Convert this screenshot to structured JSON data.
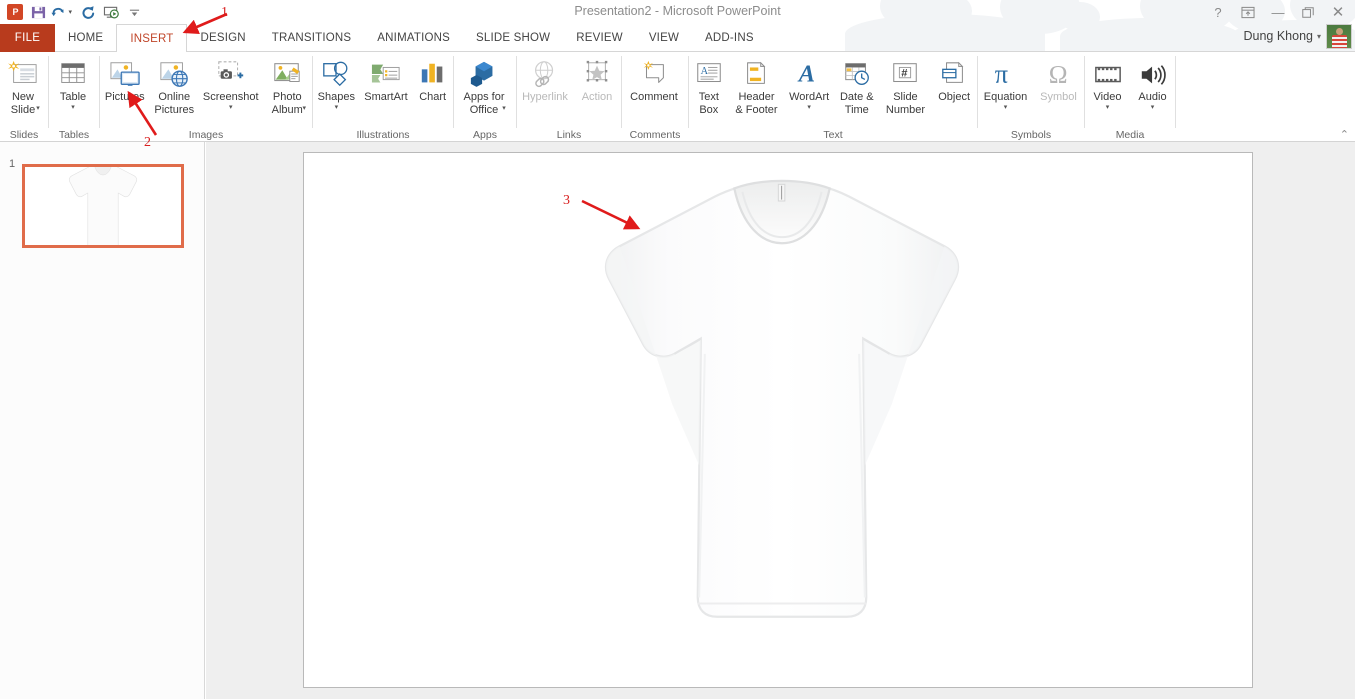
{
  "window": {
    "title": "Presentation2 - Microsoft PowerPoint",
    "help_icon": "?",
    "ribbon_display_icon": "⤒",
    "minimize_icon": "—",
    "restore_icon": "❐",
    "close_icon": "✕",
    "collapse_ribbon_icon": "⌃"
  },
  "quick_access": [
    {
      "name": "powerpoint-logo",
      "label": "P"
    },
    {
      "name": "save-icon",
      "label": "save"
    },
    {
      "name": "undo-icon",
      "label": "undo"
    },
    {
      "name": "redo-icon",
      "label": "redo"
    },
    {
      "name": "start-slideshow-icon",
      "label": "slideshow"
    },
    {
      "name": "customize-qat-icon",
      "label": "customize"
    }
  ],
  "account": {
    "name": "Dung Khong",
    "caret": "▾"
  },
  "tabs": [
    {
      "label": "FILE",
      "active": false,
      "file": true
    },
    {
      "label": "HOME",
      "active": false
    },
    {
      "label": "INSERT",
      "active": true
    },
    {
      "label": "DESIGN",
      "active": false
    },
    {
      "label": "TRANSITIONS",
      "active": false
    },
    {
      "label": "ANIMATIONS",
      "active": false
    },
    {
      "label": "SLIDE SHOW",
      "active": false
    },
    {
      "label": "REVIEW",
      "active": false
    },
    {
      "label": "VIEW",
      "active": false
    },
    {
      "label": "ADD-INS",
      "active": false
    }
  ],
  "ribbon": {
    "groups": [
      {
        "label": "Slides",
        "items": [
          {
            "name": "new-slide-button",
            "label": "New\nSlide",
            "icon": "new-slide-icon",
            "caret": true,
            "disabled": false
          }
        ]
      },
      {
        "label": "Tables",
        "items": [
          {
            "name": "table-button",
            "label": "Table",
            "icon": "table-icon",
            "caret": true,
            "disabled": false
          }
        ]
      },
      {
        "label": "Images",
        "items": [
          {
            "name": "pictures-button",
            "label": "Pictures",
            "icon": "pictures-icon",
            "caret": false,
            "disabled": false
          },
          {
            "name": "online-pictures-button",
            "label": "Online\nPictures",
            "icon": "online-pictures-icon",
            "caret": false,
            "disabled": false
          },
          {
            "name": "screenshot-button",
            "label": "Screenshot",
            "icon": "screenshot-icon",
            "caret": true,
            "disabled": false
          },
          {
            "name": "photo-album-button",
            "label": "Photo\nAlbum",
            "icon": "photo-album-icon",
            "caret": true,
            "disabled": false
          }
        ]
      },
      {
        "label": "Illustrations",
        "items": [
          {
            "name": "shapes-button",
            "label": "Shapes",
            "icon": "shapes-icon",
            "caret": true,
            "disabled": false
          },
          {
            "name": "smartart-button",
            "label": "SmartArt",
            "icon": "smartart-icon",
            "caret": false,
            "disabled": false
          },
          {
            "name": "chart-button",
            "label": "Chart",
            "icon": "chart-icon",
            "caret": false,
            "disabled": false
          }
        ]
      },
      {
        "label": "Apps",
        "items": [
          {
            "name": "apps-for-office-button",
            "label": "Apps for\nOffice",
            "icon": "apps-for-office-icon",
            "caret": true,
            "disabled": false
          }
        ]
      },
      {
        "label": "Links",
        "items": [
          {
            "name": "hyperlink-button",
            "label": "Hyperlink",
            "icon": "hyperlink-icon",
            "caret": false,
            "disabled": true
          },
          {
            "name": "action-button",
            "label": "Action",
            "icon": "action-icon",
            "caret": false,
            "disabled": true
          }
        ]
      },
      {
        "label": "Comments",
        "items": [
          {
            "name": "comment-button",
            "label": "Comment",
            "icon": "comment-icon",
            "caret": false,
            "disabled": false
          }
        ]
      },
      {
        "label": "Text",
        "items": [
          {
            "name": "text-box-button",
            "label": "Text\nBox",
            "icon": "text-box-icon",
            "caret": false,
            "disabled": false
          },
          {
            "name": "header-footer-button",
            "label": "Header\n& Footer",
            "icon": "header-footer-icon",
            "caret": false,
            "disabled": false
          },
          {
            "name": "wordart-button",
            "label": "WordArt",
            "icon": "wordart-icon",
            "caret": true,
            "disabled": false
          },
          {
            "name": "date-time-button",
            "label": "Date &\nTime",
            "icon": "date-time-icon",
            "caret": false,
            "disabled": false
          },
          {
            "name": "slide-number-button",
            "label": "Slide\nNumber",
            "icon": "slide-number-icon",
            "caret": false,
            "disabled": false
          },
          {
            "name": "object-button",
            "label": "Object",
            "icon": "object-icon",
            "caret": false,
            "disabled": false
          }
        ]
      },
      {
        "label": "Symbols",
        "items": [
          {
            "name": "equation-button",
            "label": "Equation",
            "icon": "equation-icon",
            "caret": true,
            "disabled": false
          },
          {
            "name": "symbol-button",
            "label": "Symbol",
            "icon": "symbol-icon",
            "caret": false,
            "disabled": true
          }
        ]
      },
      {
        "label": "Media",
        "items": [
          {
            "name": "video-button",
            "label": "Video",
            "icon": "video-icon",
            "caret": true,
            "disabled": false
          },
          {
            "name": "audio-button",
            "label": "Audio",
            "icon": "audio-icon",
            "caret": true,
            "disabled": false
          }
        ]
      }
    ]
  },
  "slides_panel": {
    "slide_number": "1",
    "thumbnail_alt": "white-tshirt-thumbnail"
  },
  "slide": {
    "content_alt": "white-tshirt-image"
  },
  "annotations": [
    {
      "number": "1",
      "target": "insert-tab"
    },
    {
      "number": "2",
      "target": "pictures-button"
    },
    {
      "number": "3",
      "target": "tshirt-image"
    }
  ],
  "colors": {
    "accent_red": "#d81e1e",
    "file_tab": "#b83b1d",
    "active_tab_text": "#c0462a",
    "thumb_selection": "#e06c4a",
    "office_blue": "#2b579a"
  }
}
